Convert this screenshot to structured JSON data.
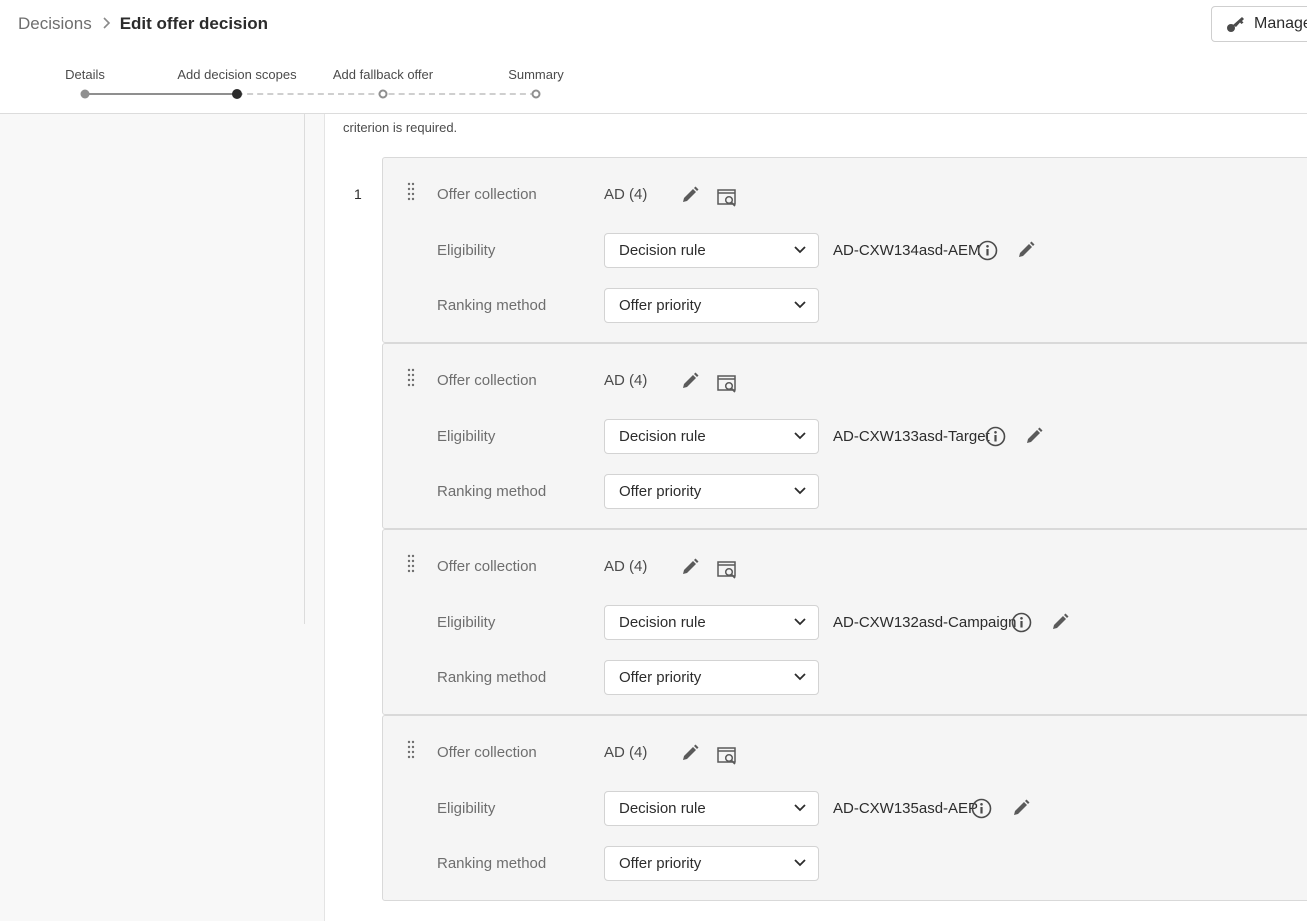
{
  "breadcrumb": {
    "parent": "Decisions",
    "separator": ">",
    "current": "Edit offer decision"
  },
  "header": {
    "manage_label": "Manage"
  },
  "steps": [
    {
      "label": "Details",
      "state": "done"
    },
    {
      "label": "Add decision scopes",
      "state": "current"
    },
    {
      "label": "Add fallback offer",
      "state": "todo"
    },
    {
      "label": "Summary",
      "state": "todo"
    }
  ],
  "helper_text": "criterion is required.",
  "rank_number": "1",
  "labels": {
    "offer_collection": "Offer collection",
    "eligibility": "Eligibility",
    "ranking_method": "Ranking method"
  },
  "cards": [
    {
      "collection": "AD (4)",
      "eligibility": "Decision rule",
      "rule_name": "AD-CXW134asd-AEM",
      "ranking": "Offer priority"
    },
    {
      "collection": "AD (4)",
      "eligibility": "Decision rule",
      "rule_name": "AD-CXW133asd-Target",
      "ranking": "Offer priority"
    },
    {
      "collection": "AD (4)",
      "eligibility": "Decision rule",
      "rule_name": "AD-CXW132asd-Campaign",
      "ranking": "Offer priority"
    },
    {
      "collection": "AD (4)",
      "eligibility": "Decision rule",
      "rule_name": "AD-CXW135asd-AEP",
      "ranking": "Offer priority"
    }
  ],
  "colors": {
    "accent": "#2c2c2c",
    "card_bg": "#f5f5f5",
    "rail_bg": "#f8f8f8"
  },
  "icons": {
    "grip": "drag-handle-icon",
    "edit": "pencil-icon",
    "preview": "preview-icon",
    "info": "info-icon",
    "chevron": "chevron-down-icon",
    "manage": "key-icon"
  }
}
